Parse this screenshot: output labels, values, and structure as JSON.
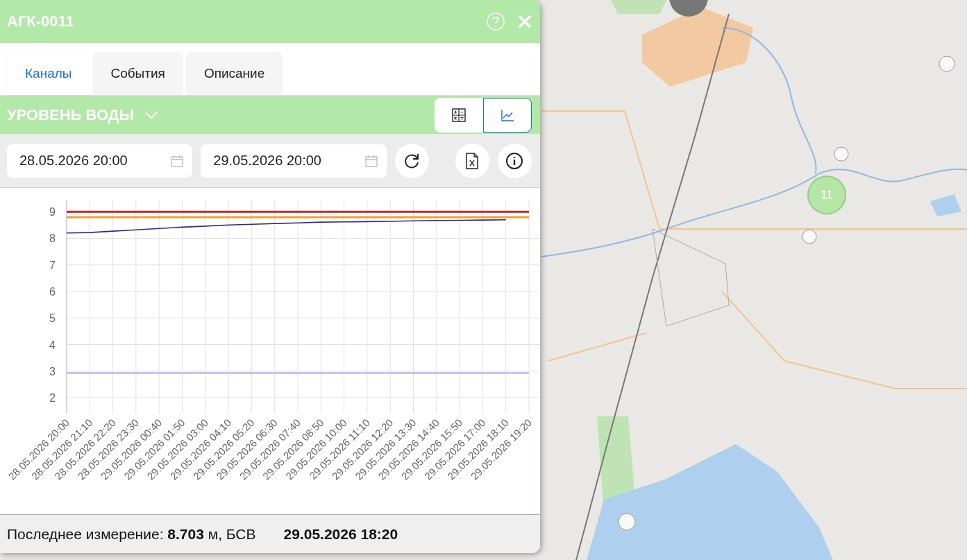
{
  "window": {
    "title": "АГК-0011"
  },
  "tabs": [
    {
      "label": "Каналы",
      "selected": true
    },
    {
      "label": "События",
      "selected": false
    },
    {
      "label": "Описание",
      "selected": false
    }
  ],
  "channel": {
    "name": "УРОВЕНЬ ВОДЫ",
    "views": [
      {
        "kind": "table",
        "selected": false
      },
      {
        "kind": "chart",
        "selected": true
      }
    ]
  },
  "period": {
    "from": "28.05.2026 20:00",
    "to": "29.05.2026 20:00"
  },
  "chart_data": {
    "type": "line",
    "grid": true,
    "ylim": [
      1.4,
      9.45
    ],
    "yticks": [
      2,
      3,
      4,
      5,
      6,
      7,
      8,
      9
    ],
    "categories": [
      "28.05.2026 20:00",
      "28.05.2026 21:10",
      "28.05.2026 22:20",
      "28.05.2026 23:30",
      "29.05.2026 00:40",
      "29.05.2026 01:50",
      "29.05.2026 03:00",
      "29.05.2026 04:10",
      "29.05.2026 05:20",
      "29.05.2026 06:30",
      "29.05.2026 07:40",
      "29.05.2026 08:50",
      "29.05.2026 10:00",
      "29.05.2026 11:10",
      "29.05.2026 12:20",
      "29.05.2026 13:30",
      "29.05.2026 14:40",
      "29.05.2026 15:50",
      "29.05.2026 17:00",
      "29.05.2026 18:10",
      "29.05.2026 19:20"
    ],
    "series": [
      {
        "color": "#c62828",
        "values": [
          9,
          9,
          9,
          9,
          9,
          9,
          9,
          9,
          9,
          9,
          9,
          9,
          9,
          9,
          9,
          9,
          9,
          9,
          9,
          9,
          9
        ]
      },
      {
        "color": "#f0a030",
        "values": [
          8.8,
          8.8,
          8.8,
          8.8,
          8.8,
          8.8,
          8.8,
          8.8,
          8.8,
          8.8,
          8.8,
          8.8,
          8.8,
          8.8,
          8.8,
          8.8,
          8.8,
          8.8,
          8.8,
          8.8,
          8.8
        ]
      },
      {
        "color": "#c5c5f0",
        "values": [
          2.93,
          2.93,
          2.93,
          2.93,
          2.93,
          2.93,
          2.93,
          2.93,
          2.93,
          2.93,
          2.93,
          2.93,
          2.93,
          2.93,
          2.93,
          2.93,
          2.93,
          2.93,
          2.93,
          2.93,
          2.93
        ]
      },
      {
        "color": "#2a2a8c",
        "values": [
          8.2,
          8.22,
          8.27,
          8.32,
          8.37,
          8.42,
          8.46,
          8.5,
          8.53,
          8.56,
          8.58,
          8.61,
          8.62,
          8.63,
          8.64,
          8.66,
          8.67,
          8.68,
          8.69,
          8.7,
          null
        ]
      }
    ]
  },
  "last_measurement": {
    "text": "Последнее измерение:  **8.703** м, БСВ",
    "time": "29.05.2026 18:20"
  },
  "map": {
    "markers": [
      {
        "count": "11"
      }
    ]
  }
}
